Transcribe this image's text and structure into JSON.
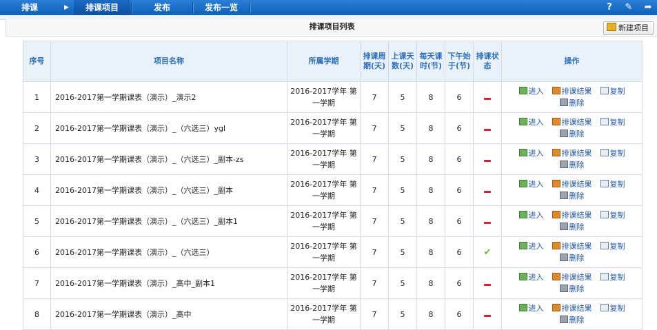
{
  "nav": {
    "items": [
      "排课",
      "排课项目",
      "发布",
      "发布一览"
    ],
    "active_index": 1,
    "right_icons": [
      "help-icon",
      "edit-icon",
      "exit-icon"
    ]
  },
  "panel": {
    "title": "排课项目列表",
    "new_button": "新建项目"
  },
  "table": {
    "headers": {
      "seq": "序号",
      "name": "项目名称",
      "term": "所属学期",
      "cycle": "排课周期(天)",
      "days": "上课天数(天)",
      "periods": "每天课时(节)",
      "afternoon": "下午始于(节)",
      "status": "排课状态",
      "ops": "操作"
    },
    "ops_labels": {
      "enter": "进入",
      "result": "排课结果",
      "copy": "复制",
      "delete": "删除"
    },
    "rows": [
      {
        "seq": "1",
        "name": "2016-2017第一学期课表（演示）_演示2",
        "term_line1": "2016-2017学年 第",
        "term_line2": "一学期",
        "cycle": "7",
        "days": "5",
        "periods": "8",
        "afternoon": "6",
        "status": "pending"
      },
      {
        "seq": "2",
        "name": "2016-2017第一学期课表（演示）_（六选三）ygl",
        "term_line1": "2016-2017学年 第",
        "term_line2": "一学期",
        "cycle": "7",
        "days": "5",
        "periods": "8",
        "afternoon": "6",
        "status": "pending"
      },
      {
        "seq": "3",
        "name": "2016-2017第一学期课表（演示）_（六选三）_副本-zs",
        "term_line1": "2016-2017学年 第",
        "term_line2": "一学期",
        "cycle": "7",
        "days": "5",
        "periods": "8",
        "afternoon": "6",
        "status": "pending"
      },
      {
        "seq": "4",
        "name": "2016-2017第一学期课表（演示）_（六选三）_副本",
        "term_line1": "2016-2017学年 第",
        "term_line2": "一学期",
        "cycle": "7",
        "days": "5",
        "periods": "8",
        "afternoon": "6",
        "status": "pending"
      },
      {
        "seq": "5",
        "name": "2016-2017第一学期课表（演示）_（六选三）_副本1",
        "term_line1": "2016-2017学年 第",
        "term_line2": "一学期",
        "cycle": "7",
        "days": "5",
        "periods": "8",
        "afternoon": "6",
        "status": "pending"
      },
      {
        "seq": "6",
        "name": "2016-2017第一学期课表（演示）_（六选三）",
        "term_line1": "2016-2017学年 第",
        "term_line2": "一学期",
        "cycle": "7",
        "days": "5",
        "periods": "8",
        "afternoon": "6",
        "status": "done"
      },
      {
        "seq": "7",
        "name": "2016-2017第一学期课表（演示）_高中_副本1",
        "term_line1": "2016-2017学年 第",
        "term_line2": "一学期",
        "cycle": "7",
        "days": "5",
        "periods": "8",
        "afternoon": "6",
        "status": "pending"
      },
      {
        "seq": "8",
        "name": "2016-2017第一学期课表（演示）_高中",
        "term_line1": "2016-2017学年 第",
        "term_line2": "一学期",
        "cycle": "7",
        "days": "5",
        "periods": "8",
        "afternoon": "6",
        "status": "pending"
      }
    ]
  },
  "colors": {
    "nav_bg": "#1a6bc4",
    "header_bg": "#e9f1fb",
    "header_text": "#2d6fb8",
    "link": "#2255a4",
    "status_pending": "#d4202a",
    "status_done": "#7fae2e"
  }
}
